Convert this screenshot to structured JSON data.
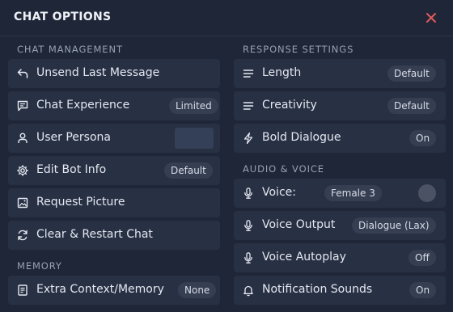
{
  "header": {
    "title": "CHAT OPTIONS"
  },
  "left": {
    "section1": "CHAT MANAGEMENT",
    "items": [
      {
        "label": "Unsend Last Message",
        "icon": "undo-icon"
      },
      {
        "label": "Chat Experience",
        "badge": "Limited",
        "icon": "chat-bubble-icon"
      },
      {
        "label": "User Persona",
        "icon": "user-icon"
      },
      {
        "label": "Edit Bot Info",
        "badge": "Default",
        "icon": "gear-icon"
      },
      {
        "label": "Request Picture",
        "icon": "image-icon"
      },
      {
        "label": "Clear & Restart Chat",
        "icon": "refresh-icon"
      }
    ],
    "section2": "MEMORY",
    "memory": {
      "label": "Extra Context/Memory",
      "badge": "None",
      "icon": "document-icon"
    }
  },
  "right": {
    "section1": "RESPONSE SETTINGS",
    "items": [
      {
        "label": "Length",
        "badge": "Default",
        "icon": "lines-icon"
      },
      {
        "label": "Creativity",
        "badge": "Default",
        "icon": "lines-icon"
      },
      {
        "label": "Bold Dialogue",
        "badge": "On",
        "icon": "lightning-icon"
      }
    ],
    "section2": "AUDIO & VOICE",
    "audio": [
      {
        "label": "Voice:",
        "badge": "Female 3",
        "icon": "microphone-icon"
      },
      {
        "label": "Voice Output",
        "badge": "Dialogue (Lax)",
        "icon": "microphone-icon"
      },
      {
        "label": "Voice Autoplay",
        "badge": "Off",
        "icon": "microphone-icon"
      },
      {
        "label": "Notification Sounds",
        "badge": "On",
        "icon": "bell-icon"
      }
    ]
  },
  "colors": {
    "background": "#1f2638",
    "row": "#283043",
    "badge": "#363e52",
    "close": "#e05a5a",
    "persona_swatch": "#334058"
  }
}
